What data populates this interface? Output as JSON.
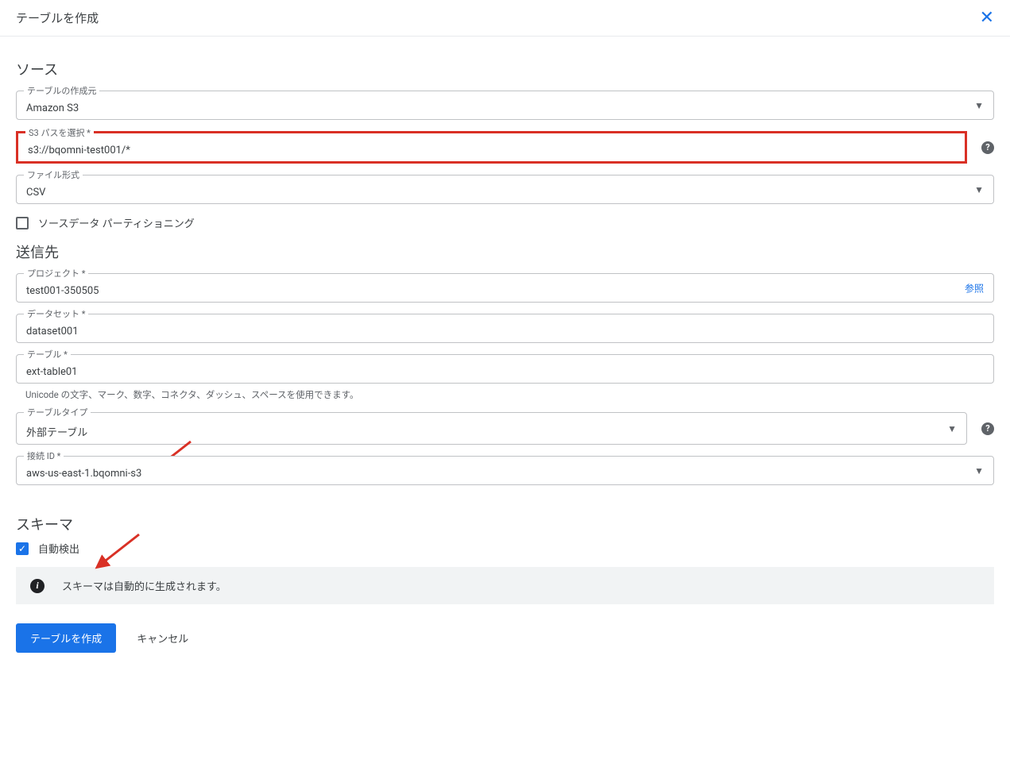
{
  "header": {
    "title": "テーブルを作成"
  },
  "source": {
    "section_title": "ソース",
    "from_label": "テーブルの作成元",
    "from_value": "Amazon S3",
    "s3path_label": "S3 パスを選択 *",
    "s3path_value": "s3://bqomni-test001/*",
    "file_format_label": "ファイル形式",
    "file_format_value": "CSV",
    "partitioning_label": "ソースデータ パーティショニング"
  },
  "destination": {
    "section_title": "送信先",
    "project_label": "プロジェクト *",
    "project_value": "test001-350505",
    "browse_label": "参照",
    "dataset_label": "データセット *",
    "dataset_value": "dataset001",
    "table_label": "テーブル *",
    "table_value": "ext-table01",
    "table_helper": "Unicode の文字、マーク、数字、コネクタ、ダッシュ、スペースを使用できます。",
    "table_type_label": "テーブルタイプ",
    "table_type_value": "外部テーブル",
    "connection_label": "接続 ID *",
    "connection_value": "aws-us-east-1.bqomni-s3"
  },
  "schema": {
    "section_title": "スキーマ",
    "auto_detect_label": "自動検出",
    "info_text": "スキーマは自動的に生成されます。"
  },
  "footer": {
    "create_label": "テーブルを作成",
    "cancel_label": "キャンセル"
  }
}
